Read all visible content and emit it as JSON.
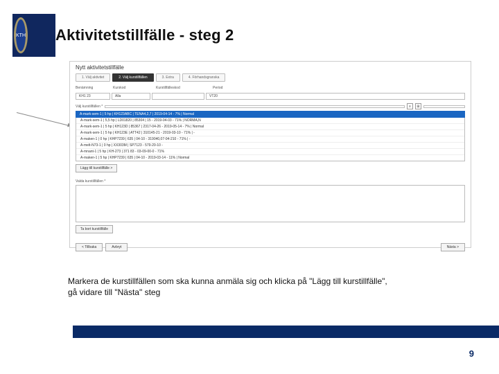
{
  "header": {
    "title": "Aktivitetstillfälle  - steg 2",
    "logo_text": "KTH"
  },
  "screenshot": {
    "page_title": "Nytt aktivitetstillfälle",
    "wizard": {
      "step1": "1. Välj aktivitet",
      "step2": "2. Välj kurstillfällen",
      "step3": "3. Extra",
      "step4": "4. Förhandsgranska"
    },
    "filters": {
      "benamning_label": "Benämning",
      "kurskod_label": "Kurskod",
      "kurstyp_label": "Kurstillfälleskod",
      "period_label": "Period",
      "benamning_value": "KH1 23",
      "kurskod_value": "Alla",
      "select_placeholder": "VT20"
    },
    "search": {
      "label": "Välj kurstillfällen *",
      "selected_header": "A-mark-sem-1 | 5 hp | KH123ABC | TENA4,2,7 | 2019-04-14 - 7% | Normal",
      "rows": [
        "A-mark-sem-1 | 5,5 hp | LD01820 | 85304 | 15 - 2019-04-03 - 71% | NORMA,N",
        "A-mark-sem-1 | 5 hp | KH123D | 85367 | 2317-04-26 - 2019-05-14 - 7% | Normal",
        "A-mark-sem-1 | 5 hp | KH123E | ATT42 | 310145-21 - 2019-03-10 - 71% | -",
        "A-maken-1 | 0 hp | KHP7239 | 635 | 04-10 - 319040,07-04-210 - 71% | -",
        "A-melt-N73-1 | 0 hp | XX303M | SP7123 - 579-20-10 -",
        "A-mnant-1 | 5 hp | KH-273 | 371 83 - 03-09-00-0 - 71%",
        "A-maken-1 | 5 hp | KHP7239 | 635 | 04-10 - 2019-03-14 - 11% | Normal"
      ]
    },
    "icons": {
      "list": "≡",
      "grid": "⊞"
    },
    "add_button": "Lägg till kurstillfälle >",
    "selected_label": "Valda kurstillfällen *",
    "remove_button": "Ta bort kurstillfälle",
    "nav": {
      "prev": "< Tillbaka",
      "cancel": "Avbryt",
      "next": "Nästa >"
    }
  },
  "caption": {
    "line1": "Markera de kurstillfällen som ska kunna anmäla sig och klicka på \"Lägg till kurstillfälle\",",
    "line2": "gå vidare till \"Nästa\" steg"
  },
  "page_number": "9"
}
